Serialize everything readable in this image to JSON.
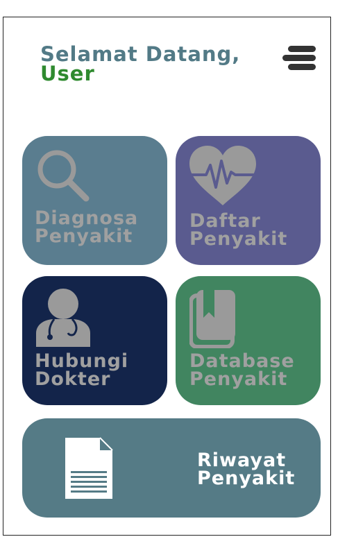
{
  "header": {
    "greeting_line1": "Selamat Datang,",
    "greeting_line2": "User",
    "menu_icon": "hamburger-menu-icon"
  },
  "colors": {
    "greeting_primary": "#527a86",
    "greeting_user": "#2f8a2f",
    "card_diagnosa": "#5a7d8f",
    "card_daftar": "#5a5b8f",
    "card_hubungi": "#13244a",
    "card_database": "#418560",
    "card_riwayat": "#557b86",
    "card_label_muted": "#a0a0a0",
    "card_label_white": "#ffffff",
    "icon_muted": "#9a9a9a"
  },
  "cards": {
    "diagnosa": {
      "line1": "Diagnosa",
      "line2": "Penyakit",
      "icon": "magnifier-search-icon"
    },
    "daftar": {
      "line1": "Daftar",
      "line2": "Penyakit",
      "icon": "heart-pulse-icon"
    },
    "hubungi": {
      "line1": "Hubungi",
      "line2": "Dokter",
      "icon": "doctor-stethoscope-icon"
    },
    "database": {
      "line1": "Database",
      "line2": "Penyakit",
      "icon": "bookmark-book-icon"
    },
    "riwayat": {
      "line1": "Riwayat",
      "line2": "Penyakit",
      "icon": "document-icon"
    }
  }
}
